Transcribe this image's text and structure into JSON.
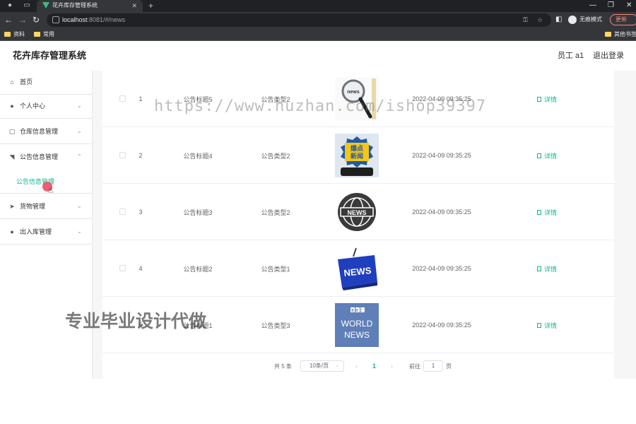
{
  "browser": {
    "tab_title": "花卉库存管理系统",
    "new_tab": "+",
    "url_host": "localhost",
    "url_rest": ":8081/#/news",
    "profile_label": "无痕模式",
    "update_label": "更新",
    "bookmarks": [
      "资料",
      "常用"
    ],
    "other_bookmarks": "其他书签"
  },
  "header": {
    "title": "花卉库存管理系统",
    "user": "员工 a1",
    "logout": "退出登录"
  },
  "sidebar": {
    "items": [
      {
        "label": "首页",
        "icon": "home-icon"
      },
      {
        "label": "个人中心",
        "icon": "user-icon"
      },
      {
        "label": "仓库信息管理",
        "icon": "box-icon"
      },
      {
        "label": "公告信息管理",
        "icon": "notice-icon"
      },
      {
        "label": "货物管理",
        "icon": "send-icon"
      },
      {
        "label": "出入库管理",
        "icon": "user-icon"
      }
    ],
    "active_sub": "公告信息管理"
  },
  "table": {
    "rows": [
      {
        "idx": "1",
        "title": "公告标题5",
        "type": "公告类型2",
        "time": "2022-04-09 09:35:25",
        "action": "详情",
        "image": "magnifier-news-image"
      },
      {
        "idx": "2",
        "title": "公告标题4",
        "type": "公告类型2",
        "time": "2022-04-09 09:35:25",
        "action": "详情",
        "image": "breaking-news-image"
      },
      {
        "idx": "3",
        "title": "公告标题3",
        "type": "公告类型2",
        "time": "2022-04-09 09:35:25",
        "action": "详情",
        "image": "globe-news-image"
      },
      {
        "idx": "4",
        "title": "公告标题2",
        "type": "公告类型1",
        "time": "2022-04-09 09:35:25",
        "action": "详情",
        "image": "news-key-image"
      },
      {
        "idx": "5",
        "title": "公告标题1",
        "type": "公告类型3",
        "time": "2022-04-09 09:35:25",
        "action": "详情",
        "image": "bbc-world-news-image"
      }
    ]
  },
  "pagination": {
    "total": "共 5 条",
    "page_size": "10条/页",
    "current": "1",
    "goto_label": "前往",
    "goto_value": "1",
    "page_suffix": "页"
  },
  "thumbs": {
    "breaking_news": "爆点新闻",
    "news": "NEWS",
    "bbc": "BBC",
    "world": "WORLD",
    "world_news": "NEWS"
  },
  "watermarks": {
    "url": "https://www.huzhan.com/ishop39397",
    "cn": "专业毕业设计代做"
  }
}
